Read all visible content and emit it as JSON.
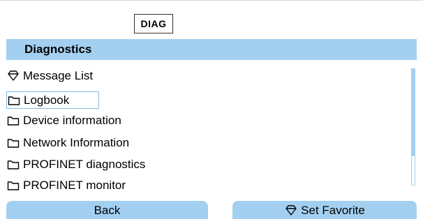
{
  "header": {
    "mode_badge": "DIAG"
  },
  "title_bar": {
    "title": "Diagnostics"
  },
  "menu": {
    "items": [
      {
        "label": "Message List",
        "icon": "favorite-diamond-icon"
      },
      {
        "label": "Logbook",
        "icon": "folder-icon",
        "selected": true
      },
      {
        "label": "Device information",
        "icon": "folder-icon"
      },
      {
        "label": "Network Information",
        "icon": "folder-icon"
      },
      {
        "label": "PROFINET diagnostics",
        "icon": "folder-icon"
      },
      {
        "label": "PROFINET monitor",
        "icon": "folder-icon"
      }
    ]
  },
  "softkeys": {
    "left_label": "Back",
    "right_label": "Set Favorite",
    "right_icon": "favorite-diamond-icon"
  },
  "colors": {
    "accent": "#a3d0f1",
    "selection_border": "#7fbbe8",
    "text": "#000000"
  }
}
